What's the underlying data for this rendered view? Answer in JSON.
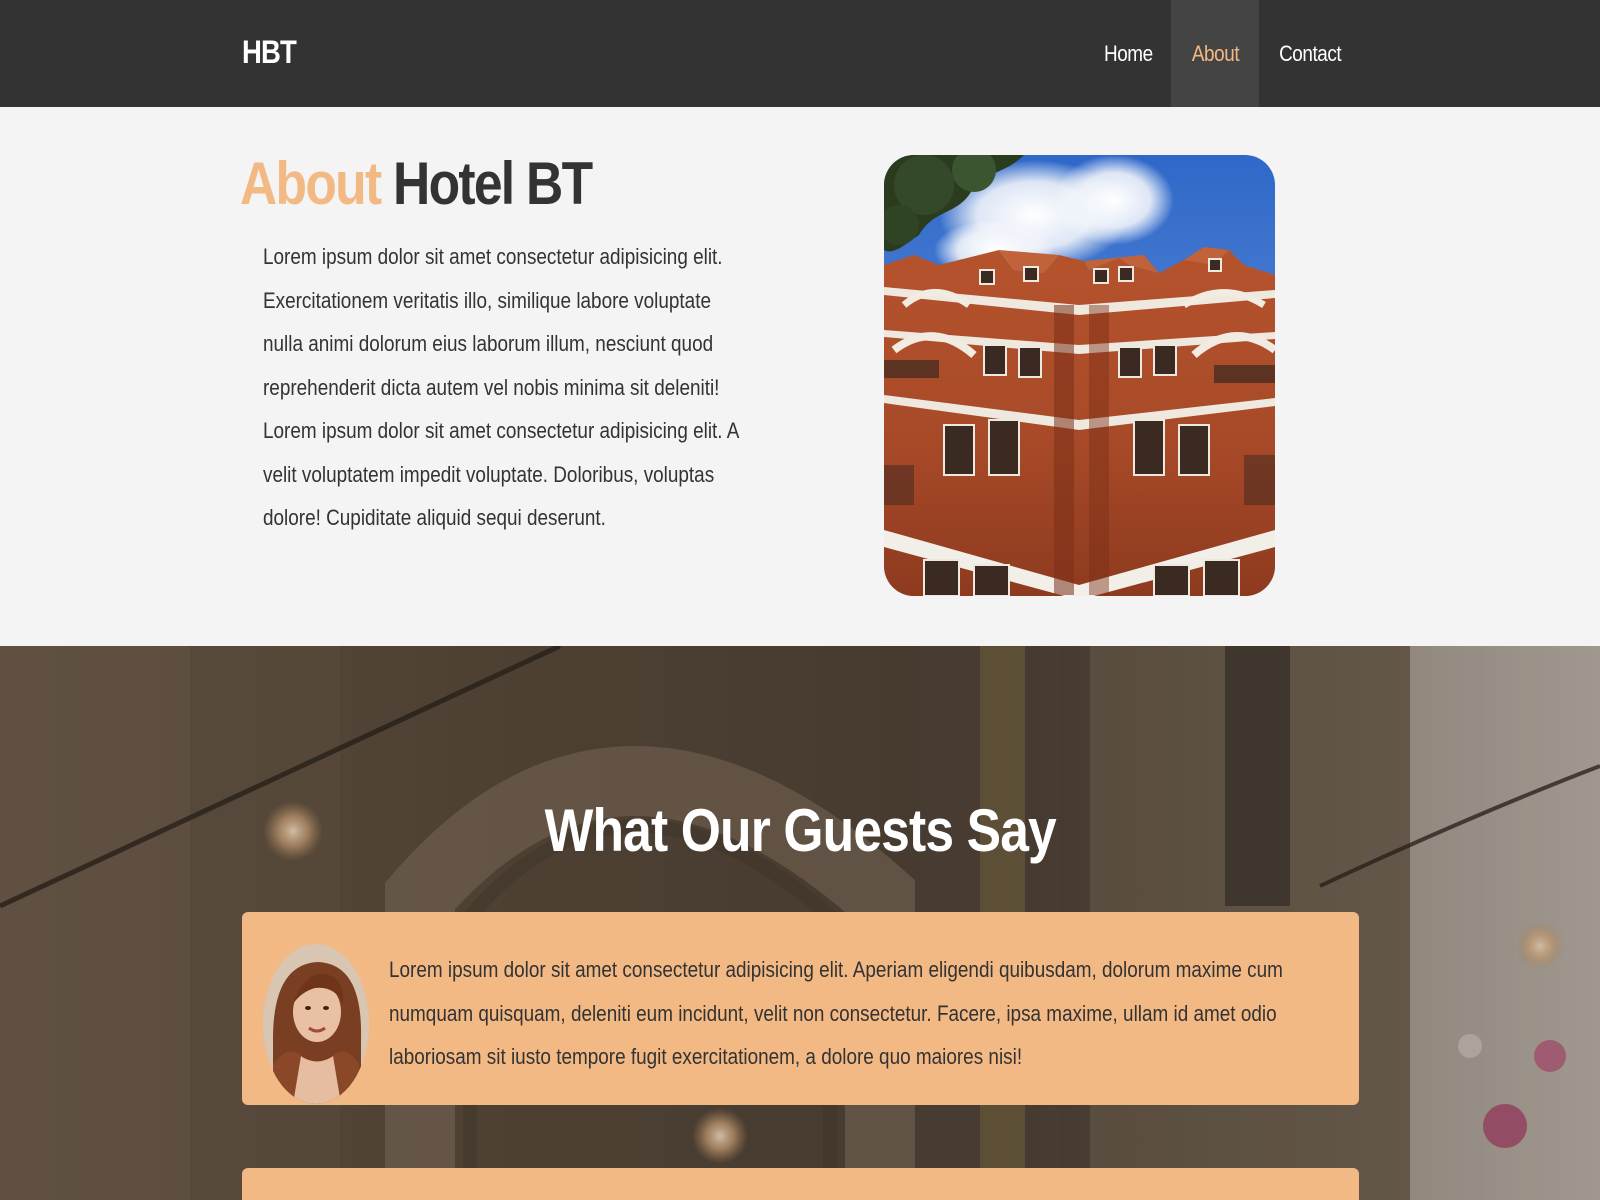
{
  "navbar": {
    "brand": "HBT",
    "links": [
      {
        "label": "Home",
        "active": false
      },
      {
        "label": "About",
        "active": true
      },
      {
        "label": "Contact",
        "active": false
      }
    ]
  },
  "about": {
    "title_accent": "About",
    "title_rest": " Hotel BT",
    "paragraphs": [
      "Lorem ipsum dolor sit amet consectetur adipisicing elit. Exercitationem veritatis illo, similique labore voluptate nulla animi dolorum eius laborum illum, nesciunt quod reprehenderit dicta autem vel nobis minima sit deleniti!",
      "Lorem ipsum dolor sit amet consectetur adipisicing elit. A velit voluptatem impedit voluptate. Doloribus, voluptas dolore! Cupiditate aliquid sequi deserunt."
    ]
  },
  "testimonials": {
    "title": "What Our Guests Say",
    "items": [
      {
        "quote": "Lorem ipsum dolor sit amet consectetur adipisicing elit. Aperiam eligendi quibusdam, dolorum maxime cum numquam quisquam, deleniti eum incidunt, velit non consectetur. Facere, ipsa maxime, ullam id amet odio laboriosam sit iusto tempore fugit exercitationem, a dolore quo maiores nisi!"
      }
    ]
  },
  "colors": {
    "navbar_bg": "#333333",
    "accent": "#f3b985",
    "active_link_bg": "#444444",
    "page_bg": "#f4f4f4",
    "text_dark": "#333333"
  }
}
